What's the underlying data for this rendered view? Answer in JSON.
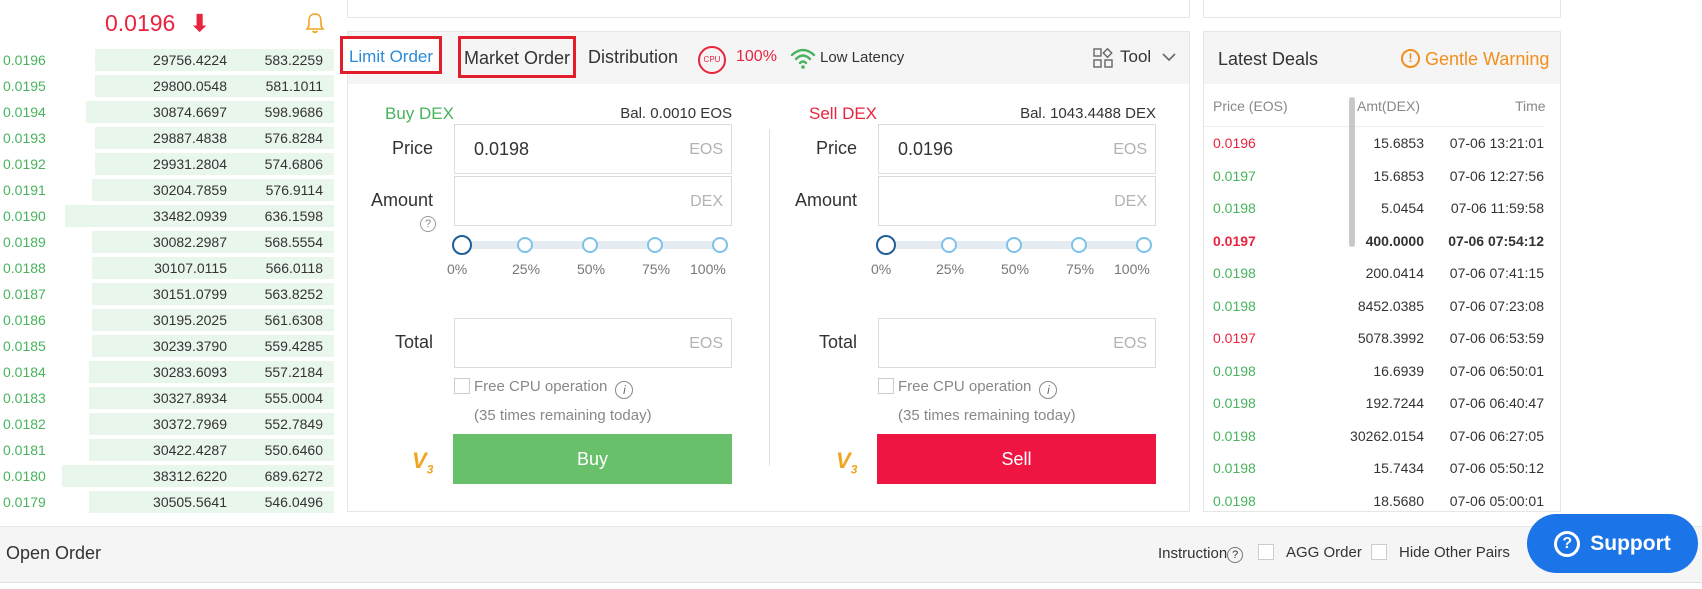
{
  "orderbook": {
    "last_price": "0.0196",
    "last_direction_arrow": "⬇",
    "rows": [
      {
        "price": "0.0196",
        "amount": "29756.4224",
        "total": "583.2259",
        "depth": 0.88
      },
      {
        "price": "0.0195",
        "amount": "29800.0548",
        "total": "581.1011",
        "depth": 0.88
      },
      {
        "price": "0.0194",
        "amount": "30874.6697",
        "total": "598.9686",
        "depth": 0.91
      },
      {
        "price": "0.0193",
        "amount": "29887.4838",
        "total": "576.8284",
        "depth": 0.88
      },
      {
        "price": "0.0192",
        "amount": "29931.2804",
        "total": "574.6806",
        "depth": 0.88
      },
      {
        "price": "0.0191",
        "amount": "30204.7859",
        "total": "576.9114",
        "depth": 0.89
      },
      {
        "price": "0.0190",
        "amount": "33482.0939",
        "total": "636.1598",
        "depth": 0.99
      },
      {
        "price": "0.0189",
        "amount": "30082.2987",
        "total": "568.5554",
        "depth": 0.89
      },
      {
        "price": "0.0188",
        "amount": "30107.0115",
        "total": "566.0118",
        "depth": 0.89
      },
      {
        "price": "0.0187",
        "amount": "30151.0799",
        "total": "563.8252",
        "depth": 0.89
      },
      {
        "price": "0.0186",
        "amount": "30195.2025",
        "total": "561.6308",
        "depth": 0.89
      },
      {
        "price": "0.0185",
        "amount": "30239.3790",
        "total": "559.4285",
        "depth": 0.89
      },
      {
        "price": "0.0184",
        "amount": "30283.6093",
        "total": "557.2184",
        "depth": 0.9
      },
      {
        "price": "0.0183",
        "amount": "30327.8934",
        "total": "555.0004",
        "depth": 0.9
      },
      {
        "price": "0.0182",
        "amount": "30372.7969",
        "total": "552.7849",
        "depth": 0.9
      },
      {
        "price": "0.0181",
        "amount": "30422.4287",
        "total": "550.6460",
        "depth": 0.9
      },
      {
        "price": "0.0180",
        "amount": "38312.6220",
        "total": "689.6272",
        "depth": 1.0
      },
      {
        "price": "0.0179",
        "amount": "30505.5641",
        "total": "546.0496",
        "depth": 0.9
      }
    ]
  },
  "tabs": {
    "limit": "Limit Order",
    "market": "Market Order",
    "distribution": "Distribution",
    "cpu_badge": "CPU",
    "cpu_percent": "100%",
    "latency": "Low Latency",
    "tool": "Tool"
  },
  "buy": {
    "title": "Buy DEX",
    "balance": "Bal. 0.0010 EOS",
    "price_label": "Price",
    "price_value": "0.0198",
    "price_unit": "EOS",
    "amount_label": "Amount",
    "amount_unit": "DEX",
    "total_label": "Total",
    "total_unit": "EOS",
    "free_cpu": "Free CPU operation",
    "remaining": "(35 times remaining today)",
    "button": "Buy",
    "slider_value": 0
  },
  "sell": {
    "title": "Sell DEX",
    "balance": "Bal. 1043.4488 DEX",
    "price_label": "Price",
    "price_value": "0.0196",
    "price_unit": "EOS",
    "amount_label": "Amount",
    "amount_unit": "DEX",
    "total_label": "Total",
    "total_unit": "EOS",
    "free_cpu": "Free CPU operation",
    "remaining": "(35 times remaining today)",
    "button": "Sell",
    "slider_value": 0
  },
  "slider_marks": [
    "0%",
    "25%",
    "50%",
    "75%",
    "100%"
  ],
  "v3_label": "V",
  "v3_sub": "3",
  "deals": {
    "title": "Latest Deals",
    "warning": "Gentle Warning",
    "col_price": "Price (EOS)",
    "col_amount": "Amt(DEX)",
    "col_time": "Time",
    "rows": [
      {
        "price": "0.0196",
        "amount": "15.6853",
        "time": "07-06 13:21:01",
        "side": "red",
        "highlight": false
      },
      {
        "price": "0.0197",
        "amount": "15.6853",
        "time": "07-06 12:27:56",
        "side": "green",
        "highlight": false
      },
      {
        "price": "0.0198",
        "amount": "5.0454",
        "time": "07-06 11:59:58",
        "side": "green",
        "highlight": false
      },
      {
        "price": "0.0197",
        "amount": "400.0000",
        "time": "07-06 07:54:12",
        "side": "red",
        "highlight": true
      },
      {
        "price": "0.0198",
        "amount": "200.0414",
        "time": "07-06 07:41:15",
        "side": "green",
        "highlight": false
      },
      {
        "price": "0.0198",
        "amount": "8452.0385",
        "time": "07-06 07:23:08",
        "side": "green",
        "highlight": false
      },
      {
        "price": "0.0197",
        "amount": "5078.3992",
        "time": "07-06 06:53:59",
        "side": "red",
        "highlight": false
      },
      {
        "price": "0.0198",
        "amount": "16.6939",
        "time": "07-06 06:50:01",
        "side": "green",
        "highlight": false
      },
      {
        "price": "0.0198",
        "amount": "192.7244",
        "time": "07-06 06:40:47",
        "side": "green",
        "highlight": false
      },
      {
        "price": "0.0198",
        "amount": "30262.0154",
        "time": "07-06 06:27:05",
        "side": "green",
        "highlight": false
      },
      {
        "price": "0.0198",
        "amount": "15.7434",
        "time": "07-06 05:50:12",
        "side": "green",
        "highlight": false
      },
      {
        "price": "0.0198",
        "amount": "18.5680",
        "time": "07-06 05:00:01",
        "side": "green",
        "highlight": false
      }
    ]
  },
  "bottom": {
    "open_order": "Open Order",
    "instruction": "Instruction",
    "agg_order": "AGG Order",
    "hide_pairs": "Hide Other Pairs",
    "support": "Support"
  },
  "colors": {
    "buy_green": "#48b35e",
    "sell_red": "#e8243f",
    "buy_button": "#68c06a",
    "sell_button": "#ee1542",
    "link_blue": "#2a8bd8",
    "warning_orange": "#f28e1c",
    "support_blue": "#1b74e8"
  },
  "icons": [
    "bell-icon",
    "cpu-icon",
    "wifi-icon",
    "tool-grid-icon",
    "chevron-down-icon",
    "question-icon",
    "info-icon",
    "v3-icon",
    "warning-icon",
    "help-icon"
  ]
}
